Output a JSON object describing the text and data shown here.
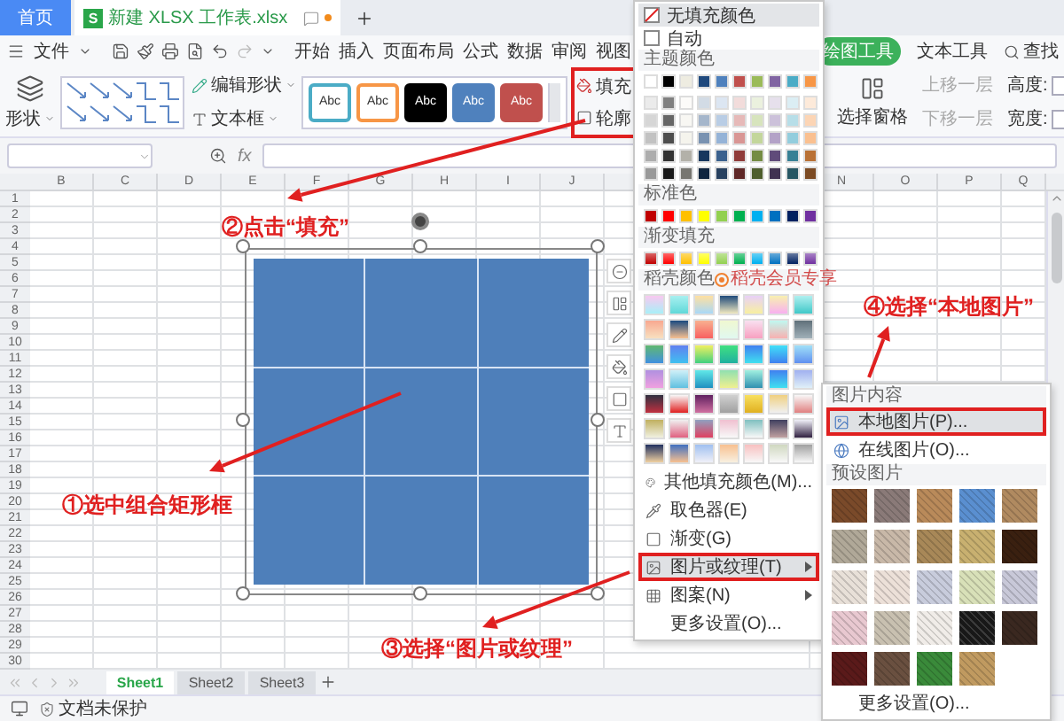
{
  "tabs": [
    {
      "label": "首页",
      "kind": "home",
      "selected": false
    },
    {
      "label": "新建 XLSX 工作表.xlsx",
      "kind": "document",
      "logo": "S",
      "selected": true
    }
  ],
  "menu_bar": {
    "file": "文件",
    "items": [
      "开始",
      "插入",
      "页面布局",
      "公式",
      "数据",
      "审阅",
      "视图"
    ],
    "context_tabs": [
      {
        "label": "绘图工具",
        "selected": true
      },
      {
        "label": "文本工具",
        "selected": false
      }
    ],
    "search": "查找"
  },
  "ribbon": {
    "shape": "形状",
    "edit_shape": "编辑形状",
    "text_box": "文本框",
    "styles": [
      {
        "label": "Abc",
        "color": "#4bacc6",
        "filled": false
      },
      {
        "label": "Abc",
        "color": "#f79646",
        "filled": false
      },
      {
        "label": "Abc",
        "color": "#000000",
        "filled": true
      },
      {
        "label": "Abc",
        "color": "#4f81bd",
        "filled": true
      },
      {
        "label": "Abc",
        "color": "#c0504d",
        "filled": true
      }
    ],
    "fill": "填充",
    "outline": "轮廓",
    "selection_pane": "选择窗格",
    "bring_forward": {
      "label": "上移一层",
      "disabled": true
    },
    "send_backward": {
      "label": "下移一层",
      "disabled": true
    },
    "height_label": "高度:",
    "width_label": "宽度:"
  },
  "formula_bar": {
    "fx": "fx"
  },
  "columns": [
    "B",
    "C",
    "D",
    "E",
    "F",
    "G",
    "H",
    "I",
    "J",
    "N",
    "O",
    "P",
    "Q"
  ],
  "rows": [
    "1",
    "2",
    "3",
    "4",
    "5",
    "6",
    "7",
    "8",
    "9",
    "10",
    "11",
    "12",
    "13",
    "14",
    "15",
    "16",
    "17",
    "18",
    "19",
    "20",
    "21",
    "22",
    "23",
    "24",
    "25",
    "26",
    "27",
    "28",
    "29",
    "30"
  ],
  "sheet_tabs": [
    {
      "label": "Sheet1",
      "selected": true
    },
    {
      "label": "Sheet2",
      "selected": false
    },
    {
      "label": "Sheet3",
      "selected": false
    }
  ],
  "status_bar": {
    "protection": "文档未保护"
  },
  "fill_menu": {
    "no_fill": "无填充颜色",
    "auto": "自动",
    "theme_colors": "主题颜色",
    "standard_colors": "标准色",
    "gradient_fill": "渐变填充",
    "docer_colors": "稻壳颜色",
    "member_only": "稻壳会员专享",
    "commands": [
      {
        "label": "其他填充颜色(M)...",
        "kind": "palette",
        "submenu": false,
        "highlighted": false
      },
      {
        "label": "取色器(E)",
        "kind": "picker",
        "submenu": false,
        "highlighted": false
      },
      {
        "label": "渐变(G)",
        "kind": "gradient",
        "submenu": false,
        "highlighted": false
      },
      {
        "label": "图片或纹理(T)",
        "kind": "picture",
        "submenu": true,
        "highlighted": true
      },
      {
        "label": "图案(N)",
        "kind": "pattern",
        "submenu": true,
        "highlighted": false
      },
      {
        "label": "更多设置(O)...",
        "kind": "plain",
        "submenu": false,
        "highlighted": false
      }
    ]
  },
  "picture_submenu": {
    "picture_content": "图片内容",
    "items": [
      {
        "label": "本地图片(P)...",
        "kind": "local",
        "highlighted": true
      },
      {
        "label": "在线图片(O)...",
        "kind": "online",
        "highlighted": false
      }
    ],
    "preset_pictures": "预设图片",
    "more": "更多设置(O)..."
  },
  "annotations": [
    {
      "label": "②点击“填充”"
    },
    {
      "label": "①选中组合矩形框"
    },
    {
      "label": "③选择“图片或纹理”"
    },
    {
      "label": "④选择“本地图片”"
    }
  ]
}
